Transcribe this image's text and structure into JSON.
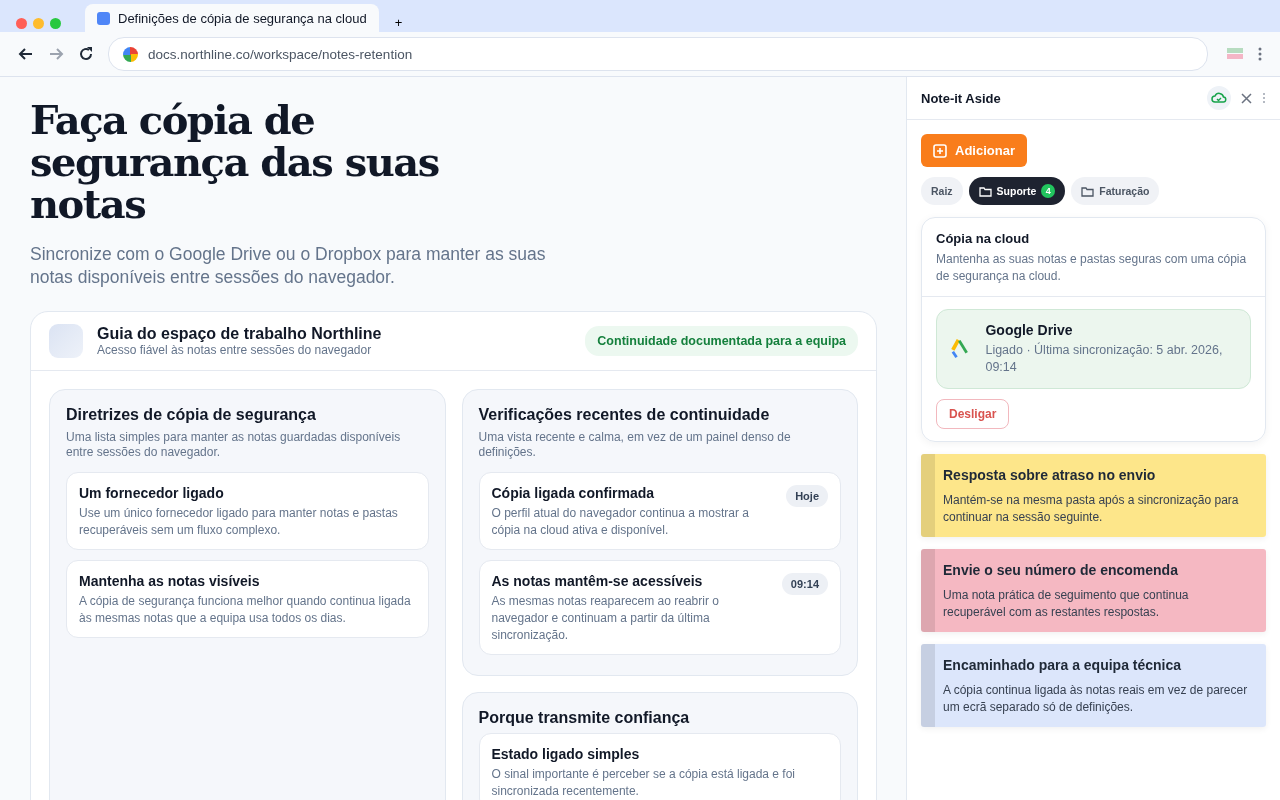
{
  "browser": {
    "tab_title": "Definições de cópia de segurança na cloud",
    "new_tab": "+",
    "url": "docs.northline.co/workspace/notes-retention"
  },
  "page": {
    "title": "Faça cópia de segurança das suas notas",
    "subtitle": "Sincronize com o Google Drive ou o Dropbox para manter as suas notas disponíveis entre sessões do navegador.",
    "guide": {
      "title": "Guia do espaço de trabalho Northline",
      "subtitle": "Acesso fiável às notas entre sessões do navegador",
      "badge": "Continuidade documentada para a equipa",
      "sections": [
        {
          "title": "Diretrizes de cópia de segurança",
          "description": "Uma lista simples para manter as notas guardadas disponíveis entre sessões do navegador.",
          "items": [
            {
              "title": "Um fornecedor ligado",
              "text": "Use um único fornecedor ligado para manter notas e pastas recuperáveis sem um fluxo complexo."
            },
            {
              "title": "Mantenha as notas visíveis",
              "text": "A cópia de segurança funciona melhor quando continua ligada às mesmas notas que a equipa usa todos os dias."
            }
          ]
        },
        {
          "title": "Verificações recentes de continuidade",
          "description": "Uma vista recente e calma, em vez de um painel denso de definições.",
          "items": [
            {
              "title": "Cópia ligada confirmada",
              "text": "O perfil atual do navegador continua a mostrar a cópia na cloud ativa e disponível.",
              "tag": "Hoje"
            },
            {
              "title": "As notas mantêm-se acessíveis",
              "text": "As mesmas notas reaparecem ao reabrir o navegador e continuam a partir da última sincronização.",
              "tag": "09:14"
            }
          ]
        },
        {
          "title": "Porque transmite confiança",
          "items": [
            {
              "title": "Estado ligado simples",
              "text": "O sinal importante é perceber se a cópia está ligada e foi sincronizada recentemente."
            }
          ]
        }
      ]
    }
  },
  "sidebar": {
    "title": "Note-it Aside",
    "add_button": "Adicionar",
    "folders": [
      {
        "label": "Raiz",
        "selected": false
      },
      {
        "label": "Suporte",
        "selected": true,
        "count": "4"
      },
      {
        "label": "Faturação",
        "selected": false
      }
    ],
    "cloud": {
      "title": "Cópia na cloud",
      "description": "Mantenha as suas notas e pastas seguras com uma cópia de segurança na cloud.",
      "provider": "Google Drive",
      "status": "Ligado · Última sincronização: 5 abr. 2026, 09:14",
      "disconnect": "Desligar"
    },
    "notes": [
      {
        "title": "Resposta sobre atraso no envio",
        "text": "Mantém-se na mesma pasta após a sincronização para continuar na sessão seguinte.",
        "color": "#fde68a"
      },
      {
        "title": "Envie o seu número de encomenda",
        "text": "Uma nota prática de seguimento que continua recuperável com as restantes respostas.",
        "color": "#f5b8c2"
      },
      {
        "title": "Encaminhado para a equipa técnica",
        "text": "A cópia continua ligada às notas reais em vez de parecer um ecrã separado só de definições.",
        "color": "#dce6fb"
      }
    ]
  }
}
